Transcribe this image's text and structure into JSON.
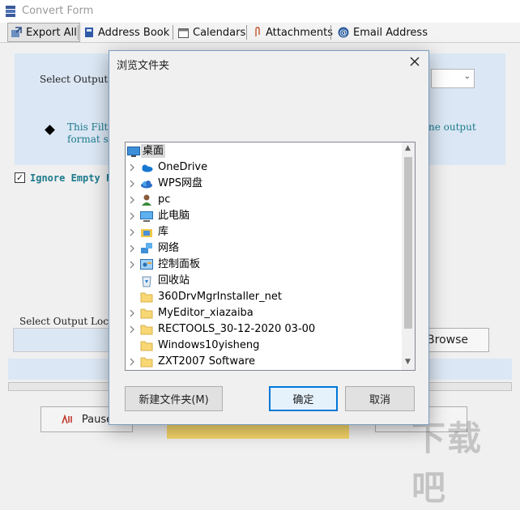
{
  "window": {
    "title": "Convert Form"
  },
  "toolbar": {
    "tabs": [
      {
        "label": "Export All",
        "icon": "export-icon"
      },
      {
        "label": "Address Book",
        "icon": "address-book-icon"
      },
      {
        "label": "Calendars",
        "icon": "calendar-icon"
      },
      {
        "label": "Attachments",
        "icon": "attachment-icon"
      },
      {
        "label": "Email Address",
        "icon": "at-icon"
      }
    ]
  },
  "main": {
    "select_output_label": "Select Output F",
    "info_line1": "This Filte",
    "info_line1_tail": "ne output",
    "info_line2": "format se",
    "ignore_empty_label": "Ignore Empty F",
    "ignore_empty_checked": true,
    "output_location_label": "Select Output Locat",
    "browse_label": "Browse",
    "pause_label": "Pause"
  },
  "dialog": {
    "title": "浏览文件夹",
    "tree_items": [
      {
        "label": "桌面",
        "icon": "desktop-icon",
        "selected": true,
        "expandable": false
      },
      {
        "label": "OneDrive",
        "icon": "onedrive-cloud-icon",
        "expandable": true
      },
      {
        "label": "WPS网盘",
        "icon": "wps-cloud-icon",
        "expandable": true
      },
      {
        "label": "pc",
        "icon": "user-icon",
        "expandable": true
      },
      {
        "label": "此电脑",
        "icon": "computer-icon",
        "expandable": true
      },
      {
        "label": "库",
        "icon": "library-icon",
        "expandable": true
      },
      {
        "label": "网络",
        "icon": "network-icon",
        "expandable": true
      },
      {
        "label": "控制面板",
        "icon": "control-panel-icon",
        "expandable": true
      },
      {
        "label": "回收站",
        "icon": "recycle-bin-icon",
        "expandable": false
      },
      {
        "label": "360DrvMgrInstaller_net",
        "icon": "folder-icon",
        "expandable": false
      },
      {
        "label": "MyEditor_xiazaiba",
        "icon": "folder-icon",
        "expandable": true
      },
      {
        "label": "RECTOOLS_30-12-2020 03-00",
        "icon": "folder-icon",
        "expandable": true
      },
      {
        "label": "Windows10yisheng",
        "icon": "folder-icon",
        "expandable": false
      },
      {
        "label": "ZXT2007 Software",
        "icon": "folder-icon",
        "expandable": true
      }
    ],
    "new_folder_label": "新建文件夹(M)",
    "ok_label": "确定",
    "cancel_label": "取消"
  },
  "watermark": {
    "text": "下载吧"
  },
  "colors": {
    "panel_blue": "#dbe7f4",
    "info_teal": "#1c7a8c",
    "primary_border": "#0078d7",
    "yellow": "#f6d66a"
  }
}
